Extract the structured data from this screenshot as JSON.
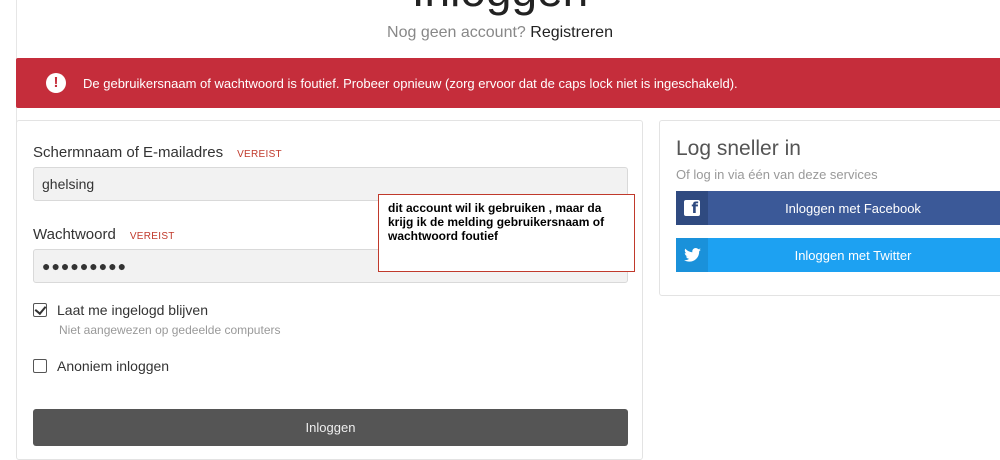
{
  "header": {
    "title": "Inloggen",
    "subtitle_prefix": "Nog geen account?",
    "register_link": "Registreren"
  },
  "alert": {
    "icon": "exclamation-icon",
    "message": "De gebruikersnaam of wachtwoord is foutief. Probeer opnieuw (zorg ervoor dat de caps lock niet is ingeschakeld).",
    "color": "#c52d3b"
  },
  "login_form": {
    "username": {
      "label": "Schermnaam of E-mailadres",
      "required": "VEREIST",
      "value": "ghelsing"
    },
    "password": {
      "label": "Wachtwoord",
      "required": "VEREIST",
      "value": "●●●●●●●●●"
    },
    "remember": {
      "label": "Laat me ingelogd blijven",
      "hint": "Niet aangewezen op gedeelde computers",
      "checked": true
    },
    "anonymous": {
      "label": "Anoniem inloggen",
      "checked": false
    },
    "submit_label": "Inloggen"
  },
  "annotation": {
    "text": "dit account wil ik gebruiken , maar da krijg ik de melding gebruikersnaam of wachtwoord foutief"
  },
  "social": {
    "title": "Log sneller in",
    "subtitle": "Of log in via één van deze services",
    "facebook_label": "Inloggen met Facebook",
    "twitter_label": "Inloggen met Twitter",
    "facebook_color": "#3b5998",
    "twitter_color": "#1da1f2"
  }
}
